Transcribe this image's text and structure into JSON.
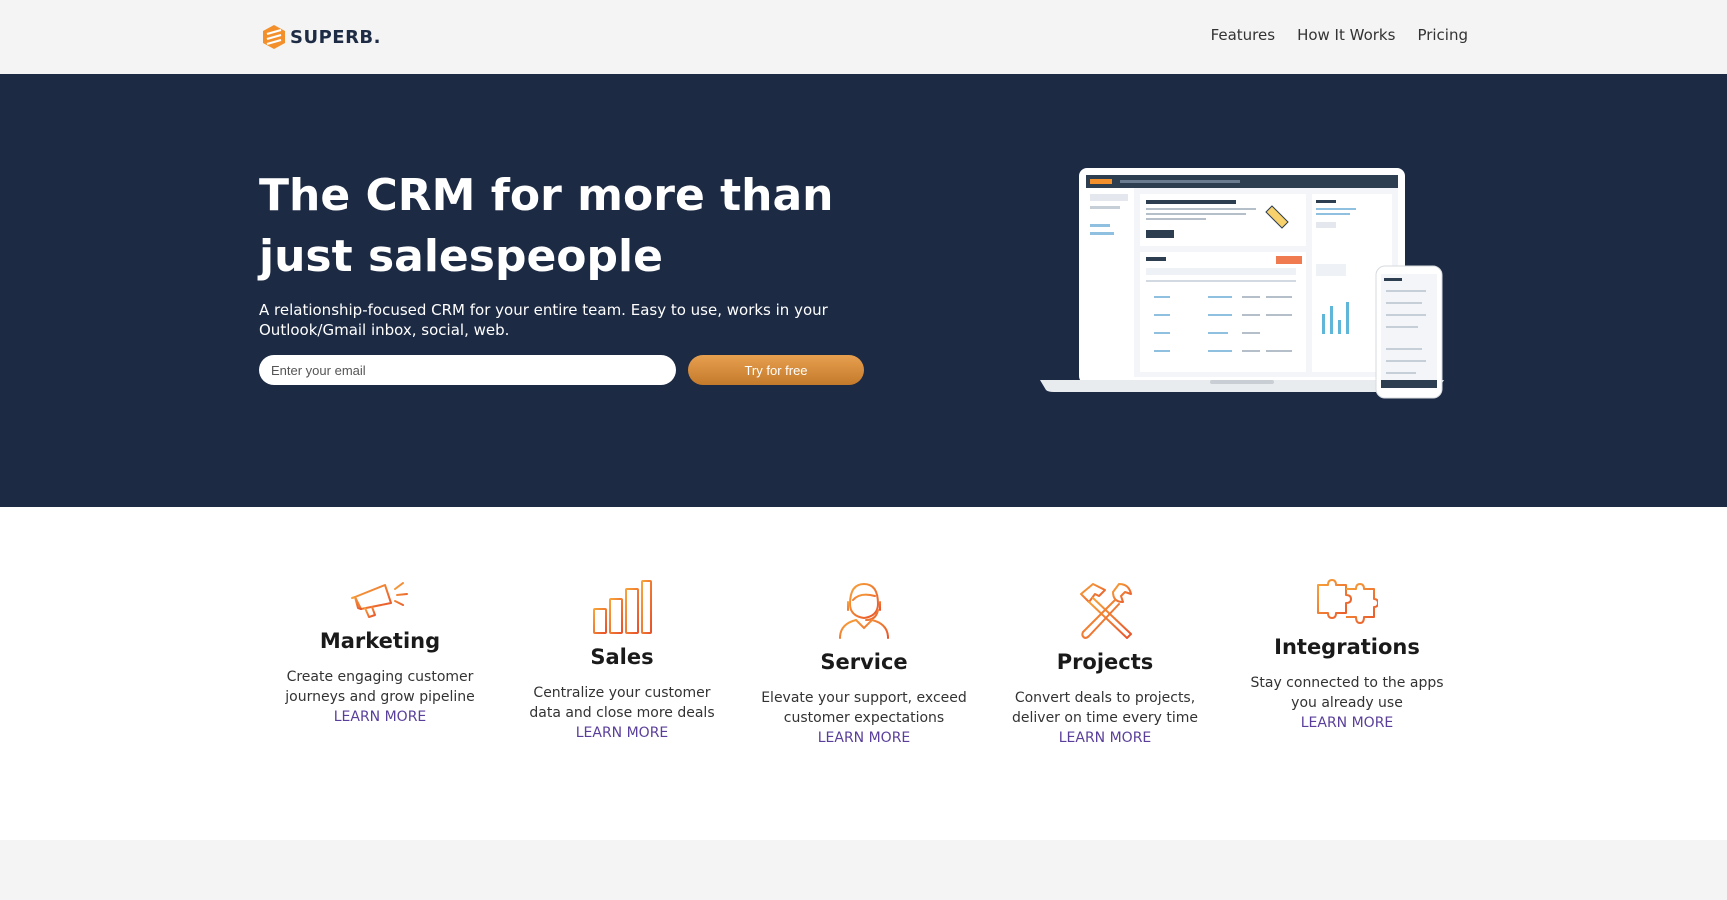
{
  "brand": {
    "name": "SUPERB.",
    "accent": "#f3902c",
    "navy": "#1c2a44"
  },
  "nav": {
    "items": [
      "Features",
      "How It Works",
      "Pricing"
    ]
  },
  "hero": {
    "title": "The CRM for more than just salespeople",
    "subtitle": "A relationship-focused CRM for your entire team. Easy to use, works in your Outlook/Gmail inbox, social, web.",
    "email_placeholder": "Enter your email",
    "cta_label": "Try for free"
  },
  "features": [
    {
      "icon": "megaphone-icon",
      "title": "Marketing",
      "description": "Create engaging customer journeys and grow pipeline",
      "link": "LEARN MORE"
    },
    {
      "icon": "bar-chart-icon",
      "title": "Sales",
      "description": "Centralize your customer data and close more deals",
      "link": "LEARN MORE"
    },
    {
      "icon": "support-agent-icon",
      "title": "Service",
      "description": "Elevate your support, exceed customer expectations",
      "link": "LEARN MORE"
    },
    {
      "icon": "tools-icon",
      "title": "Projects",
      "description": "Convert deals to projects, deliver on time every time",
      "link": "LEARN MORE"
    },
    {
      "icon": "puzzle-icon",
      "title": "Integrations",
      "description": "Stay connected to the apps you already use",
      "link": "LEARN MORE"
    }
  ]
}
